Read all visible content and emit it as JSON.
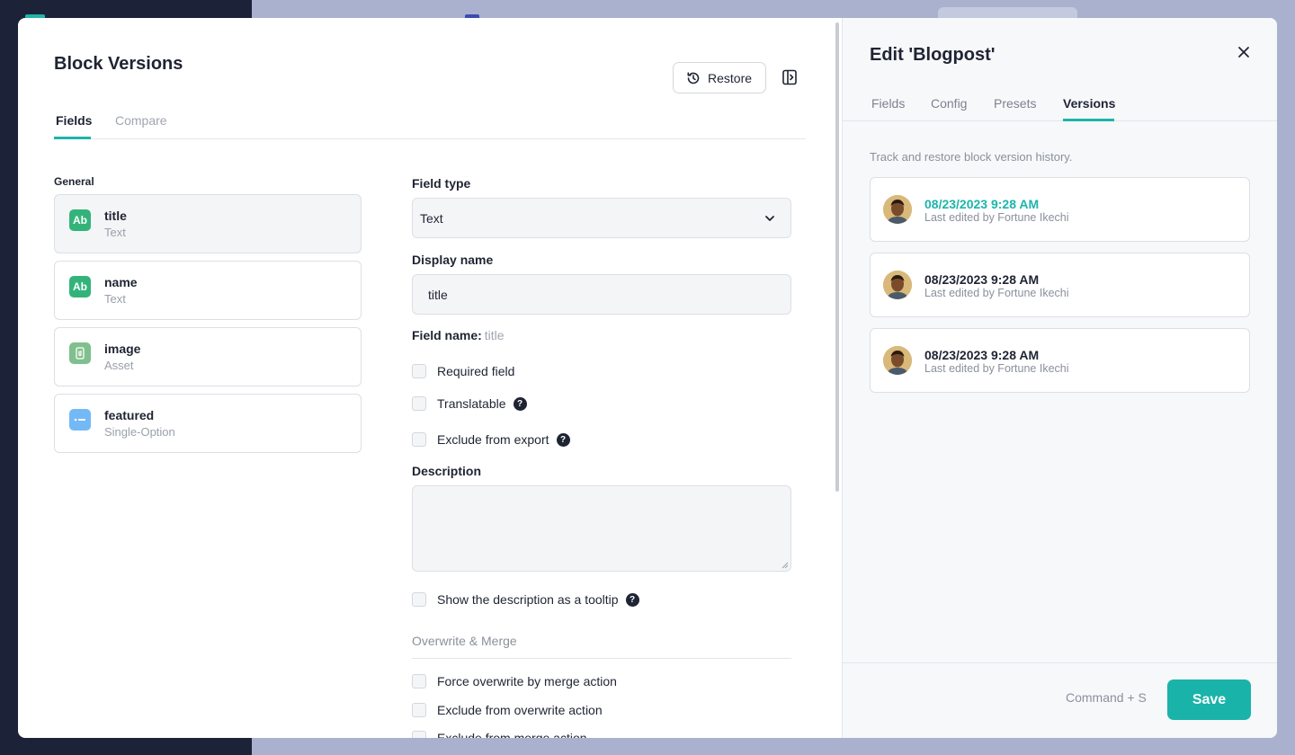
{
  "modal": {
    "title": "Block Versions",
    "restore_label": "Restore",
    "tabs": [
      {
        "label": "Fields"
      },
      {
        "label": "Compare"
      }
    ],
    "group_label": "General",
    "fields": [
      {
        "name": "title",
        "type": "Text",
        "icon": "text-field-icon",
        "icon_text": "Ab",
        "color": "#33b37a"
      },
      {
        "name": "name",
        "type": "Text",
        "icon": "text-field-icon",
        "icon_text": "Ab",
        "color": "#33b37a"
      },
      {
        "name": "image",
        "type": "Asset",
        "icon": "asset-field-icon",
        "icon_text": "",
        "color": "#7fc08e"
      },
      {
        "name": "featured",
        "type": "Single-Option",
        "icon": "option-field-icon",
        "icon_text": "",
        "color": "#74b9f5"
      }
    ]
  },
  "form": {
    "field_type_label": "Field type",
    "field_type_value": "Text",
    "display_name_label": "Display name",
    "display_name_value": "title",
    "field_name_label": "Field name:",
    "field_name_value": "title",
    "required_label": "Required field",
    "translatable_label": "Translatable",
    "exclude_export_label": "Exclude from export",
    "description_label": "Description",
    "tooltip_label": "Show the description as a tooltip",
    "overwrite_heading": "Overwrite & Merge",
    "force_overwrite_label": "Force overwrite by merge action",
    "exclude_overwrite_label": "Exclude from overwrite action",
    "exclude_merge_label": "Exclude from merge action",
    "help_glyph": "?"
  },
  "side": {
    "title": "Edit 'Blogpost'",
    "tabs": [
      {
        "label": "Fields"
      },
      {
        "label": "Config"
      },
      {
        "label": "Presets"
      },
      {
        "label": "Versions"
      }
    ],
    "description": "Track and restore block version history.",
    "versions": [
      {
        "date": "08/23/2023 9:28 AM",
        "by": "Last edited by Fortune Ikechi",
        "current": true
      },
      {
        "date": "08/23/2023 9:28 AM",
        "by": "Last edited by Fortune Ikechi",
        "current": false
      },
      {
        "date": "08/23/2023 9:28 AM",
        "by": "Last edited by Fortune Ikechi",
        "current": false
      }
    ],
    "shortcut": "Command + S",
    "save_label": "Save"
  },
  "colors": {
    "accent": "#1cb5aa",
    "sidebar_dark": "#1c2237",
    "overlay": "#a9b1cf"
  }
}
